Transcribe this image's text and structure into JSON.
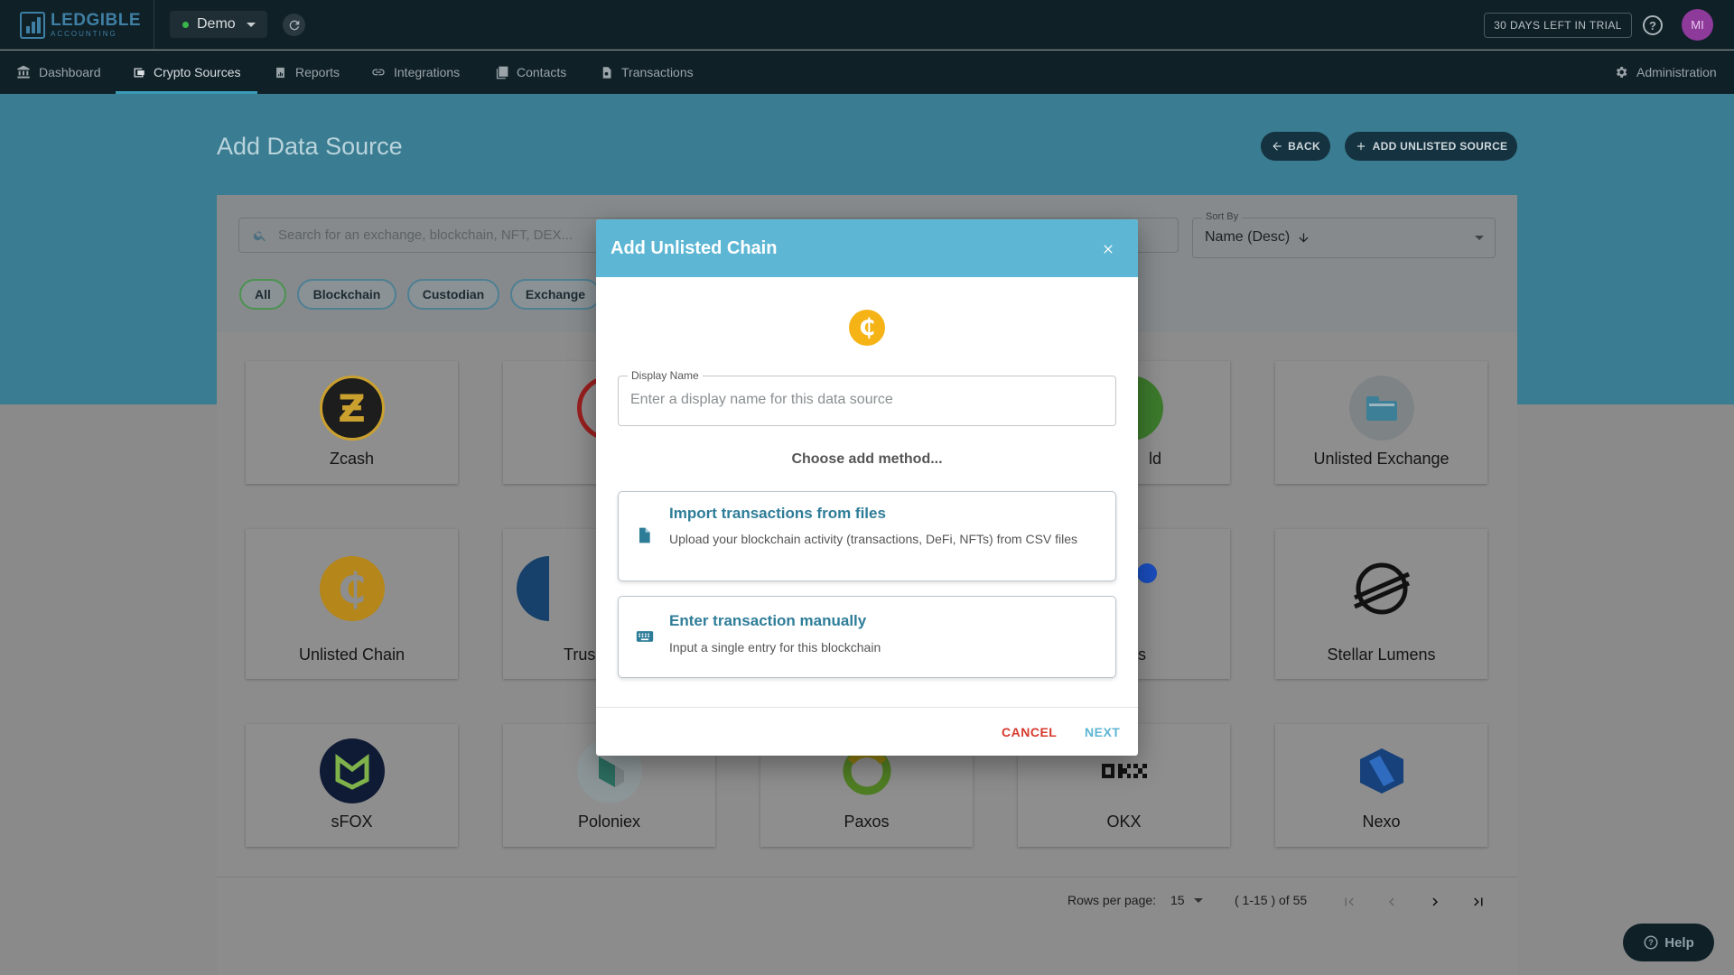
{
  "app": {
    "logo_text": "LEDGIBLE",
    "logo_sub": "ACCOUNTING",
    "workspace": "Demo",
    "trial_badge": "30 DAYS LEFT IN TRIAL",
    "avatar_initials": "MI"
  },
  "nav": {
    "items": [
      {
        "label": "Dashboard",
        "icon": "bank-icon"
      },
      {
        "label": "Crypto Sources",
        "icon": "wallet-icon",
        "active": true
      },
      {
        "label": "Reports",
        "icon": "report-icon"
      },
      {
        "label": "Integrations",
        "icon": "link-icon"
      },
      {
        "label": "Contacts",
        "icon": "contacts-icon"
      },
      {
        "label": "Transactions",
        "icon": "transactions-icon"
      }
    ],
    "admin_label": "Administration"
  },
  "page": {
    "title": "Add Data Source",
    "back_label": "BACK",
    "add_unlisted_label": "ADD UNLISTED SOURCE",
    "search_placeholder": "Search for an exchange, blockchain, NFT, DEX...",
    "sort_label": "Sort By",
    "sort_value": "Name (Desc)",
    "chips": [
      "All",
      "Blockchain",
      "Custodian",
      "Exchange"
    ],
    "sources": [
      {
        "name": "Zcash",
        "icon": "zcash-icon"
      },
      {
        "name": "",
        "icon": "tron-icon"
      },
      {
        "name": "ld",
        "icon": "green-icon"
      },
      {
        "name": "Unlisted Exchange",
        "icon": "folder-icon"
      },
      {
        "name": "Unlisted Chain",
        "icon": "coin-icon"
      },
      {
        "name": "Trus",
        "icon": "trust-icon"
      },
      {
        "name": "s",
        "icon": "blue-dot-icon"
      },
      {
        "name": "Stellar Lumens",
        "icon": "stellar-icon"
      },
      {
        "name": "sFOX",
        "icon": "sfox-icon"
      },
      {
        "name": "Poloniex",
        "icon": "poloniex-icon"
      },
      {
        "name": "Paxos",
        "icon": "paxos-icon"
      },
      {
        "name": "OKX",
        "icon": "okx-icon"
      },
      {
        "name": "Nexo",
        "icon": "nexo-icon"
      }
    ],
    "rows_per_page_label": "Rows per page:",
    "rows_per_page_value": "15",
    "range_text": "( 1-15 ) of 55",
    "help_label": "Help"
  },
  "modal": {
    "title": "Add Unlisted Chain",
    "display_name_label": "Display Name",
    "display_name_placeholder": "Enter a display name for this data source",
    "display_name_value": "",
    "choose_text": "Choose add method...",
    "methods": [
      {
        "title": "Import transactions from files",
        "desc": "Upload your blockchain activity (transactions, DeFi, NFTs) from CSV files",
        "icon": "file-icon"
      },
      {
        "title": "Enter transaction manually",
        "desc": "Input a single entry for this blockchain",
        "icon": "keyboard-icon"
      }
    ],
    "cancel_label": "CANCEL",
    "next_label": "NEXT"
  },
  "colors": {
    "topbar": "#0f2027",
    "accent": "#5cb6d4",
    "cancel": "#d6382c",
    "coin": "#f5b316"
  }
}
